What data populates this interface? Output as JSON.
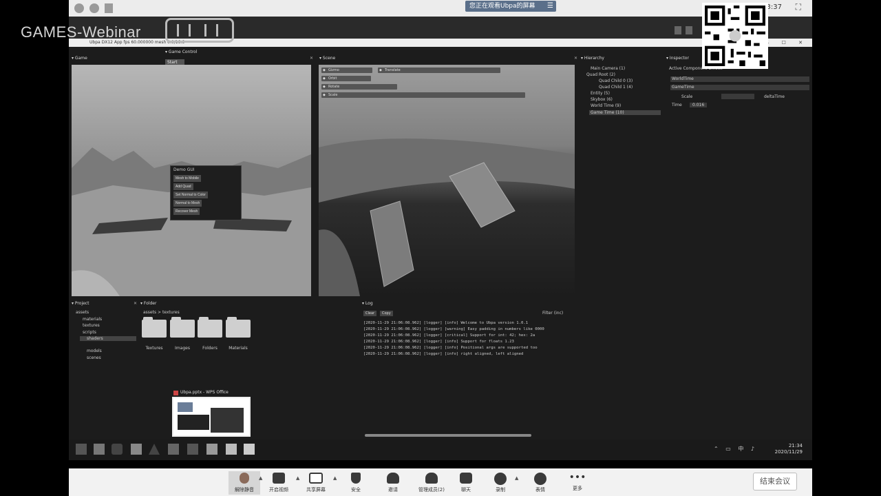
{
  "meeting": {
    "share_banner": "您正在观看Ubpa的屏幕",
    "time_fragment": "3:37",
    "end_button": "结束会议",
    "toolbar": [
      {
        "name": "unmute",
        "label": "解除静音"
      },
      {
        "name": "video",
        "label": "开启视频"
      },
      {
        "name": "share",
        "label": "共享屏幕"
      },
      {
        "name": "security",
        "label": "安全"
      },
      {
        "name": "invite",
        "label": "邀请"
      },
      {
        "name": "participants",
        "label": "管理成员(2)"
      },
      {
        "name": "chat",
        "label": "聊天"
      },
      {
        "name": "record",
        "label": "录制"
      },
      {
        "name": "reactions",
        "label": "表情"
      },
      {
        "name": "more",
        "label": "更多"
      }
    ]
  },
  "watermark": {
    "text": "GAMES-Webinar"
  },
  "editor": {
    "title": "Ubpa DX12 App    fps 60.000000    mesh 0.0/16.6",
    "menu": "Game Control",
    "menu_selected": "Start",
    "panes": {
      "game": "Game",
      "scene": "Scene",
      "hierarchy": "Hierarchy",
      "inspector": "Inspector",
      "project": "Project",
      "folder": "Folder",
      "log": "Log"
    },
    "demo_panel": {
      "title": "Demo GUI",
      "buttons": [
        "Mesh to Mobile",
        "Add Quad",
        "Set Normal to Color",
        "Normal to Mesh",
        "Recover Mesh"
      ]
    },
    "scene_chips": [
      "Gizmo",
      "Translate",
      "Orbit",
      "Rotate",
      "Scale"
    ],
    "hierarchy": [
      "Main Camera (1)",
      "Quad Root (2)",
      "Quad Child 0 (3)",
      "Quad Child 1 (4)",
      "Entity (5)",
      "Skybox (6)",
      "World Time (9)",
      "Game Time (10)"
    ],
    "inspector": {
      "header": "Active Component        Unlock",
      "rows": [
        "WorldTime",
        "GameTime",
        "Scale",
        "Time"
      ],
      "value_label": "deltaTime",
      "value": "0.016"
    },
    "project_tree": [
      "assets",
      "materials",
      "textures",
      "scripts",
      "shaders",
      "models",
      "scenes"
    ],
    "folder_path": "assets > textures",
    "folders": [
      "Textures",
      "Images",
      "Folders",
      "Materials"
    ],
    "log_buttons": [
      "Clear",
      "Copy"
    ],
    "log_filter": "Filter (inc)",
    "log_lines": [
      "[2020-11-29 21:06:08.962] [logger] [info] Welcome to Ubpa version 1.0.1",
      "[2020-11-29 21:06:08.962] [logger] [warning] Easy padding in numbers like 0000",
      "[2020-11-29 21:06:08.962] [logger] [critical] Support for int: 42;  hex: 2a",
      "[2020-11-29 21:06:08.962] [logger] [info] Support for floats 1.23",
      "[2020-11-29 21:06:08.962] [logger] [info] Positional args are supported too",
      "[2020-11-29 21:06:08.962] [logger] [info]      right aligned, left     aligned"
    ],
    "thumbnail_title": "Ubpa.pptx - WPS Office",
    "taskbar_time": "21:34",
    "taskbar_date": "2020/11/29"
  }
}
